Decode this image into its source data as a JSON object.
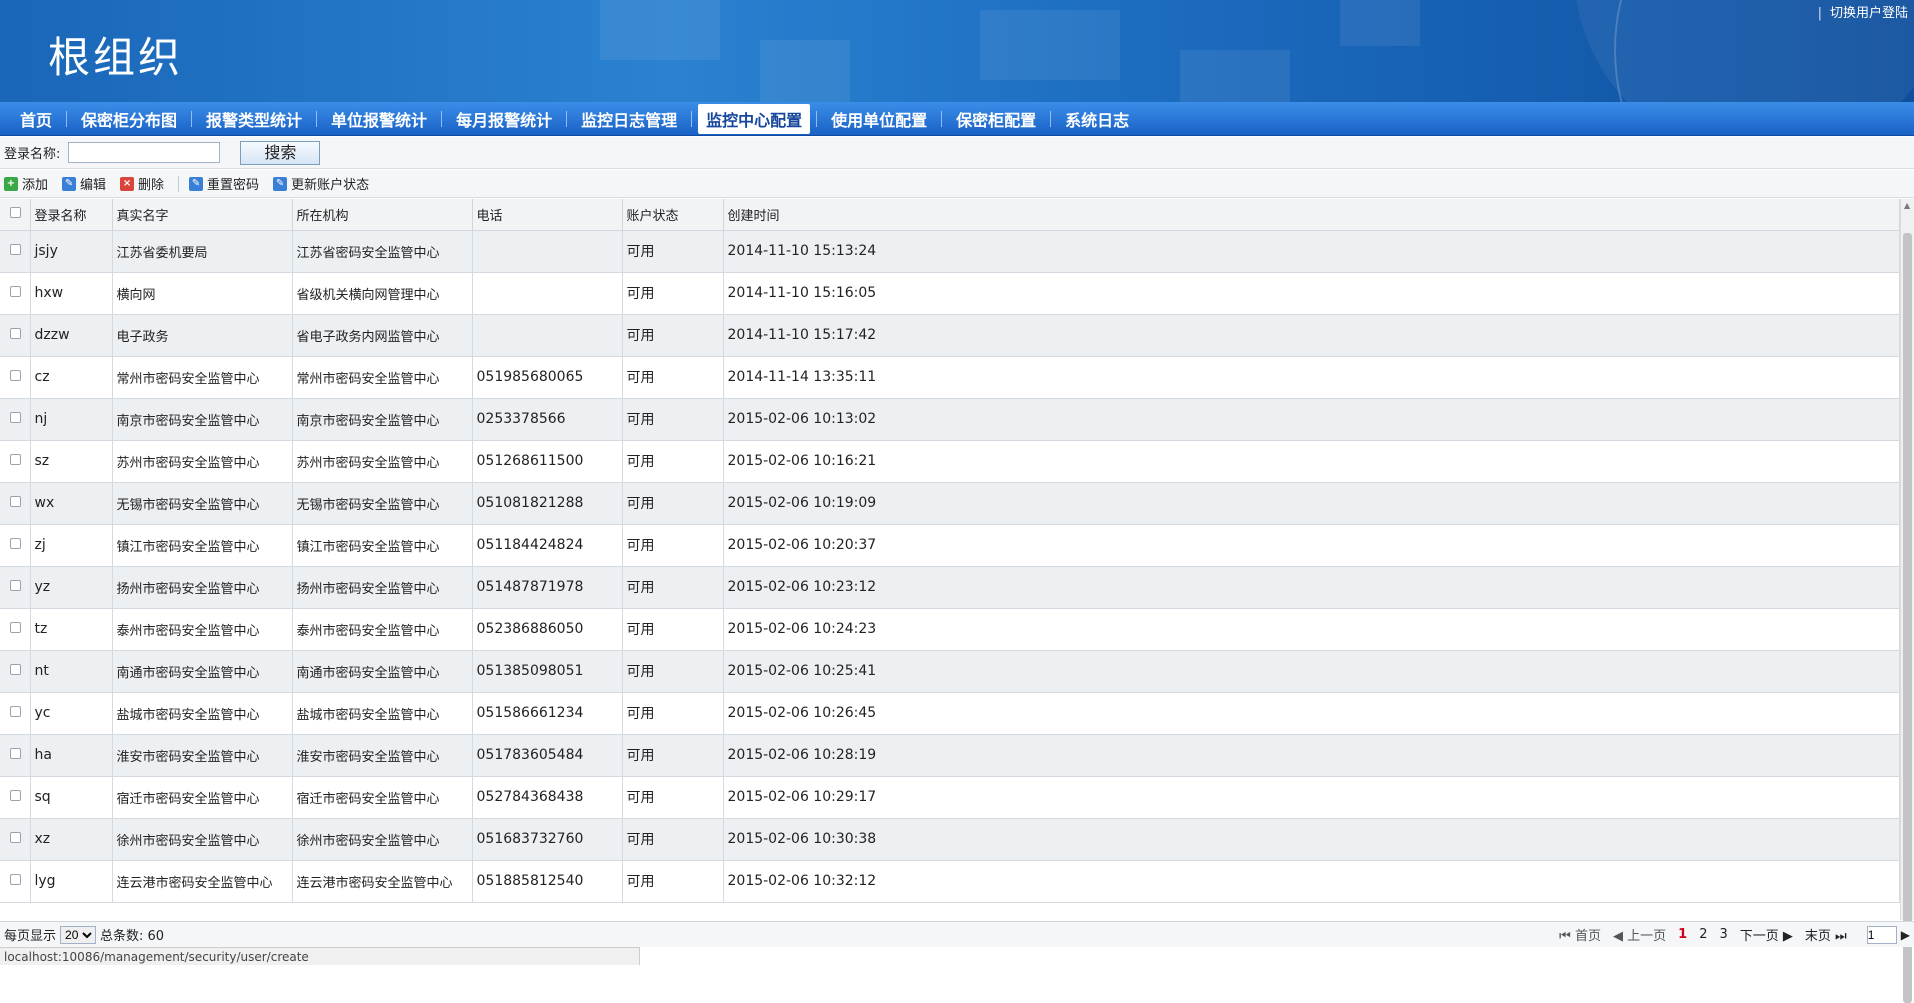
{
  "banner": {
    "title": "根组织",
    "switch_user": "切换用户登陆",
    "separator": "|"
  },
  "nav": {
    "items": [
      "首页",
      "保密柜分布图",
      "报警类型统计",
      "单位报警统计",
      "每月报警统计",
      "监控日志管理",
      "监控中心配置",
      "使用单位配置",
      "保密柜配置",
      "系统日志"
    ],
    "active": "监控中心配置"
  },
  "search": {
    "label": "登录名称:",
    "value": "",
    "button": "搜索"
  },
  "toolbar": {
    "add": "添加",
    "edit": "编辑",
    "delete": "删除",
    "reset_password": "重置密码",
    "update_status": "更新账户状态"
  },
  "table": {
    "headers": [
      "登录名称",
      "真实名字",
      "所在机构",
      "电话",
      "账户状态",
      "创建时间"
    ],
    "rows": [
      [
        "jsjy",
        "江苏省委机要局",
        "江苏省密码安全监管中心",
        "",
        "可用",
        "2014-11-10 15:13:24"
      ],
      [
        "hxw",
        "横向网",
        "省级机关横向网管理中心",
        "",
        "可用",
        "2014-11-10 15:16:05"
      ],
      [
        "dzzw",
        "电子政务",
        "省电子政务内网监管中心",
        "",
        "可用",
        "2014-11-10 15:17:42"
      ],
      [
        "cz",
        "常州市密码安全监管中心",
        "常州市密码安全监管中心",
        "051985680065",
        "可用",
        "2014-11-14 13:35:11"
      ],
      [
        "nj",
        "南京市密码安全监管中心",
        "南京市密码安全监管中心",
        "0253378566",
        "可用",
        "2015-02-06 10:13:02"
      ],
      [
        "sz",
        "苏州市密码安全监管中心",
        "苏州市密码安全监管中心",
        "051268611500",
        "可用",
        "2015-02-06 10:16:21"
      ],
      [
        "wx",
        "无锡市密码安全监管中心",
        "无锡市密码安全监管中心",
        "051081821288",
        "可用",
        "2015-02-06 10:19:09"
      ],
      [
        "zj",
        "镇江市密码安全监管中心",
        "镇江市密码安全监管中心",
        "051184424824",
        "可用",
        "2015-02-06 10:20:37"
      ],
      [
        "yz",
        "扬州市密码安全监管中心",
        "扬州市密码安全监管中心",
        "051487871978",
        "可用",
        "2015-02-06 10:23:12"
      ],
      [
        "tz",
        "泰州市密码安全监管中心",
        "泰州市密码安全监管中心",
        "052386886050",
        "可用",
        "2015-02-06 10:24:23"
      ],
      [
        "nt",
        "南通市密码安全监管中心",
        "南通市密码安全监管中心",
        "051385098051",
        "可用",
        "2015-02-06 10:25:41"
      ],
      [
        "yc",
        "盐城市密码安全监管中心",
        "盐城市密码安全监管中心",
        "051586661234",
        "可用",
        "2015-02-06 10:26:45"
      ],
      [
        "ha",
        "淮安市密码安全监管中心",
        "淮安市密码安全监管中心",
        "051783605484",
        "可用",
        "2015-02-06 10:28:19"
      ],
      [
        "sq",
        "宿迁市密码安全监管中心",
        "宿迁市密码安全监管中心",
        "052784368438",
        "可用",
        "2015-02-06 10:29:17"
      ],
      [
        "xz",
        "徐州市密码安全监管中心",
        "徐州市密码安全监管中心",
        "051683732760",
        "可用",
        "2015-02-06 10:30:38"
      ],
      [
        "lyg",
        "连云港市密码安全监管中心",
        "连云港市密码安全监管中心",
        "051885812540",
        "可用",
        "2015-02-06 10:32:12"
      ]
    ]
  },
  "pager": {
    "per_page_label": "每页显示",
    "per_page": "20",
    "total_label": "总条数: 60",
    "first": "首页",
    "prev": "上一页",
    "next": "下一页",
    "last": "末页",
    "pages": [
      "1",
      "2",
      "3"
    ],
    "current": "1",
    "page_input": "1"
  },
  "statusbar": {
    "url": "localhost:10086/management/security/user/create"
  },
  "colors": {
    "banner": "#1a66b8",
    "nav": "#2470d6",
    "current_page": "#d0021b"
  }
}
